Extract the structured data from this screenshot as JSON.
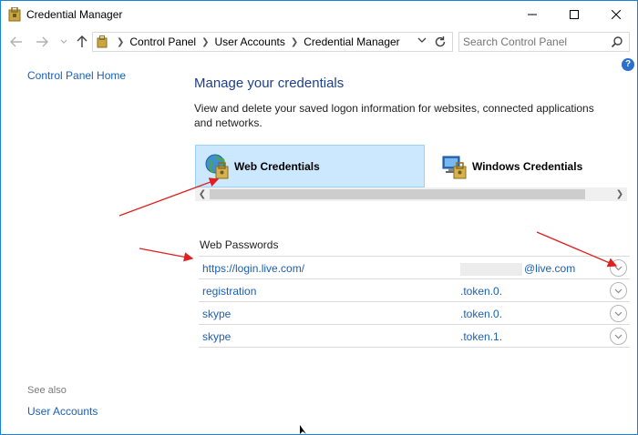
{
  "window": {
    "title": "Credential Manager",
    "controls": {
      "minimize": "minimize-icon",
      "maximize": "maximize-icon",
      "close": "close-icon"
    }
  },
  "address_bar": {
    "breadcrumbs": [
      "Control Panel",
      "User Accounts",
      "Credential Manager"
    ],
    "search_placeholder": "Search Control Panel"
  },
  "left_nav": {
    "home_link": "Control Panel Home",
    "see_also_label": "See also",
    "see_also_links": [
      "User Accounts"
    ]
  },
  "main": {
    "heading": "Manage your credentials",
    "description": "View and delete your saved logon information for websites, connected applications and networks.",
    "tabs": [
      {
        "label": "Web Credentials",
        "selected": true,
        "icon": "web-credentials-icon"
      },
      {
        "label": "Windows Credentials",
        "selected": false,
        "icon": "windows-credentials-icon"
      }
    ],
    "section_title": "Web Passwords",
    "credentials": [
      {
        "address": "https://login.live.com/",
        "user": "@live.com"
      },
      {
        "address": "registration",
        "user": ".token.0."
      },
      {
        "address": "skype",
        "user": ".token.0."
      },
      {
        "address": "skype",
        "user": ".token.1."
      }
    ]
  },
  "colors": {
    "accent_border": "#1883d7",
    "link": "#1a5fb4",
    "heading": "#1f3f8a",
    "tab_selected": "#cce8ff",
    "annotation_arrow": "#e02020"
  }
}
